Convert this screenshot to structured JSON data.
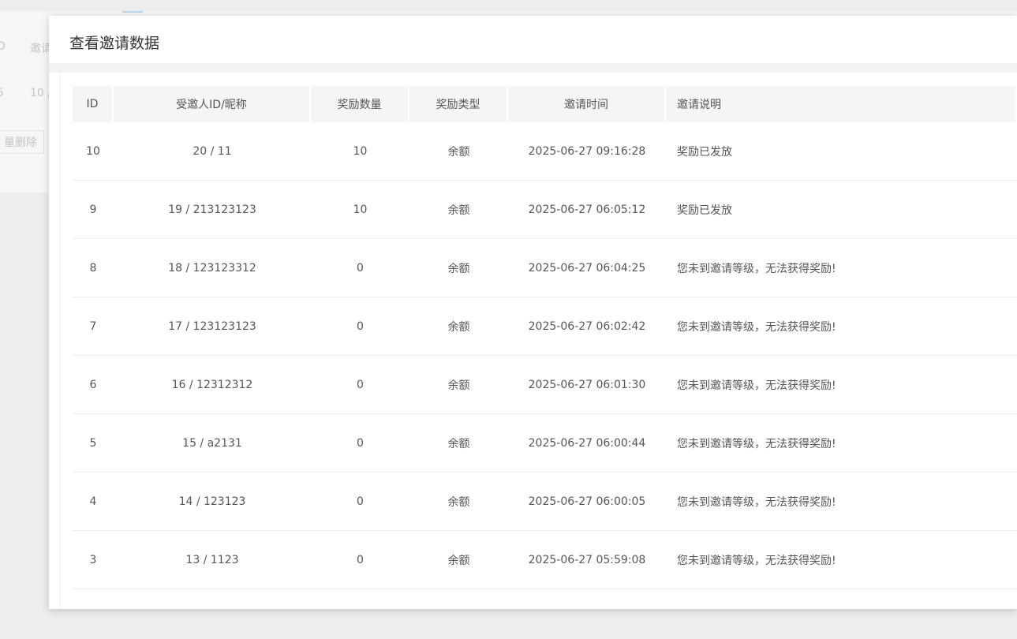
{
  "background": {
    "col_id_label": "D",
    "col_invite_label": "邀请",
    "row_id": "5",
    "row_value": "10 /",
    "batch_delete_label": "量删除"
  },
  "modal": {
    "title": "查看邀请数据"
  },
  "table": {
    "headers": {
      "id": "ID",
      "invitee": "受邀人ID/昵称",
      "reward_amount": "奖励数量",
      "reward_type": "奖励类型",
      "invite_time": "邀请时间",
      "description": "邀请说明"
    },
    "rows": [
      {
        "id": "10",
        "invitee": "20 / 11",
        "reward_amount": "10",
        "reward_type": "余额",
        "invite_time": "2025-06-27 09:16:28",
        "description": "奖励已发放"
      },
      {
        "id": "9",
        "invitee": "19 / 213123123",
        "reward_amount": "10",
        "reward_type": "余额",
        "invite_time": "2025-06-27 06:05:12",
        "description": "奖励已发放"
      },
      {
        "id": "8",
        "invitee": "18 / 123123312",
        "reward_amount": "0",
        "reward_type": "余额",
        "invite_time": "2025-06-27 06:04:25",
        "description": "您未到邀请等级，无法获得奖励!"
      },
      {
        "id": "7",
        "invitee": "17 / 123123123",
        "reward_amount": "0",
        "reward_type": "余额",
        "invite_time": "2025-06-27 06:02:42",
        "description": "您未到邀请等级，无法获得奖励!"
      },
      {
        "id": "6",
        "invitee": "16 / 12312312",
        "reward_amount": "0",
        "reward_type": "余额",
        "invite_time": "2025-06-27 06:01:30",
        "description": "您未到邀请等级，无法获得奖励!"
      },
      {
        "id": "5",
        "invitee": "15 / a2131",
        "reward_amount": "0",
        "reward_type": "余额",
        "invite_time": "2025-06-27 06:00:44",
        "description": "您未到邀请等级，无法获得奖励!"
      },
      {
        "id": "4",
        "invitee": "14 / 123123",
        "reward_amount": "0",
        "reward_type": "余额",
        "invite_time": "2025-06-27 06:00:05",
        "description": "您未到邀请等级，无法获得奖励!"
      },
      {
        "id": "3",
        "invitee": "13 / 1123",
        "reward_amount": "0",
        "reward_type": "余额",
        "invite_time": "2025-06-27 05:59:08",
        "description": "您未到邀请等级，无法获得奖励!"
      }
    ]
  }
}
